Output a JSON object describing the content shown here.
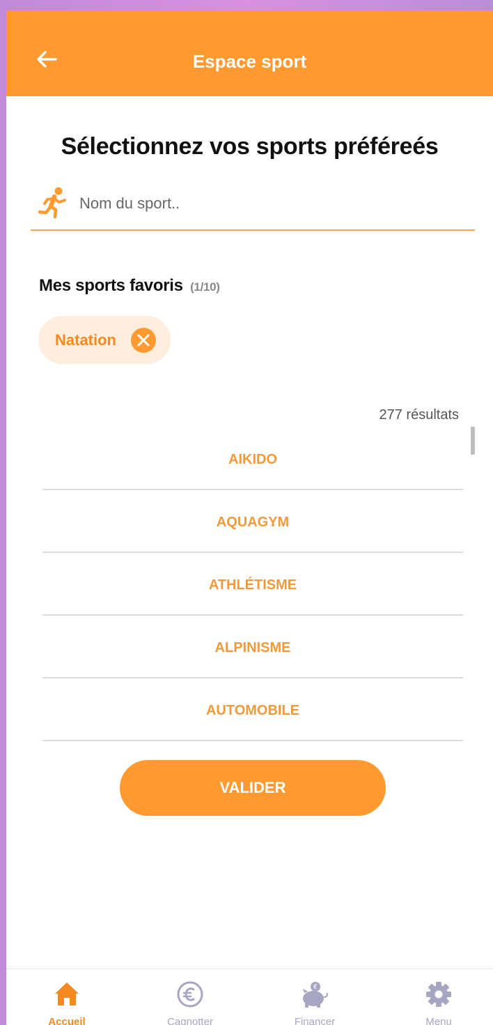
{
  "header": {
    "title": "Espace sport"
  },
  "page": {
    "title": "Sélectionnez vos sports préféreés"
  },
  "search": {
    "placeholder": "Nom du sport.."
  },
  "favorites": {
    "title": "Mes sports favoris",
    "count": "(1/10)",
    "items": [
      {
        "label": "Natation"
      }
    ]
  },
  "results": {
    "count_label": "277 résultats",
    "items": [
      {
        "label": "AIKIDO"
      },
      {
        "label": "AQUAGYM"
      },
      {
        "label": "ATHLÉTISME"
      },
      {
        "label": "ALPINISME"
      },
      {
        "label": "AUTOMOBILE"
      }
    ]
  },
  "actions": {
    "validate_label": "VALIDER"
  },
  "bottom_nav": {
    "items": [
      {
        "label": "Accueil",
        "icon": "home-icon",
        "active": true
      },
      {
        "label": "Cagnotter",
        "icon": "euro-coin-icon",
        "active": false
      },
      {
        "label": "Financer",
        "icon": "piggy-bank-icon",
        "active": false
      },
      {
        "label": "Menu",
        "icon": "gear-icon",
        "active": false
      }
    ]
  },
  "colors": {
    "accent": "#ff9a31",
    "accent_text": "#f29a3a",
    "chip_bg": "#ffeddd",
    "nav_inactive": "#a6a6c2"
  }
}
